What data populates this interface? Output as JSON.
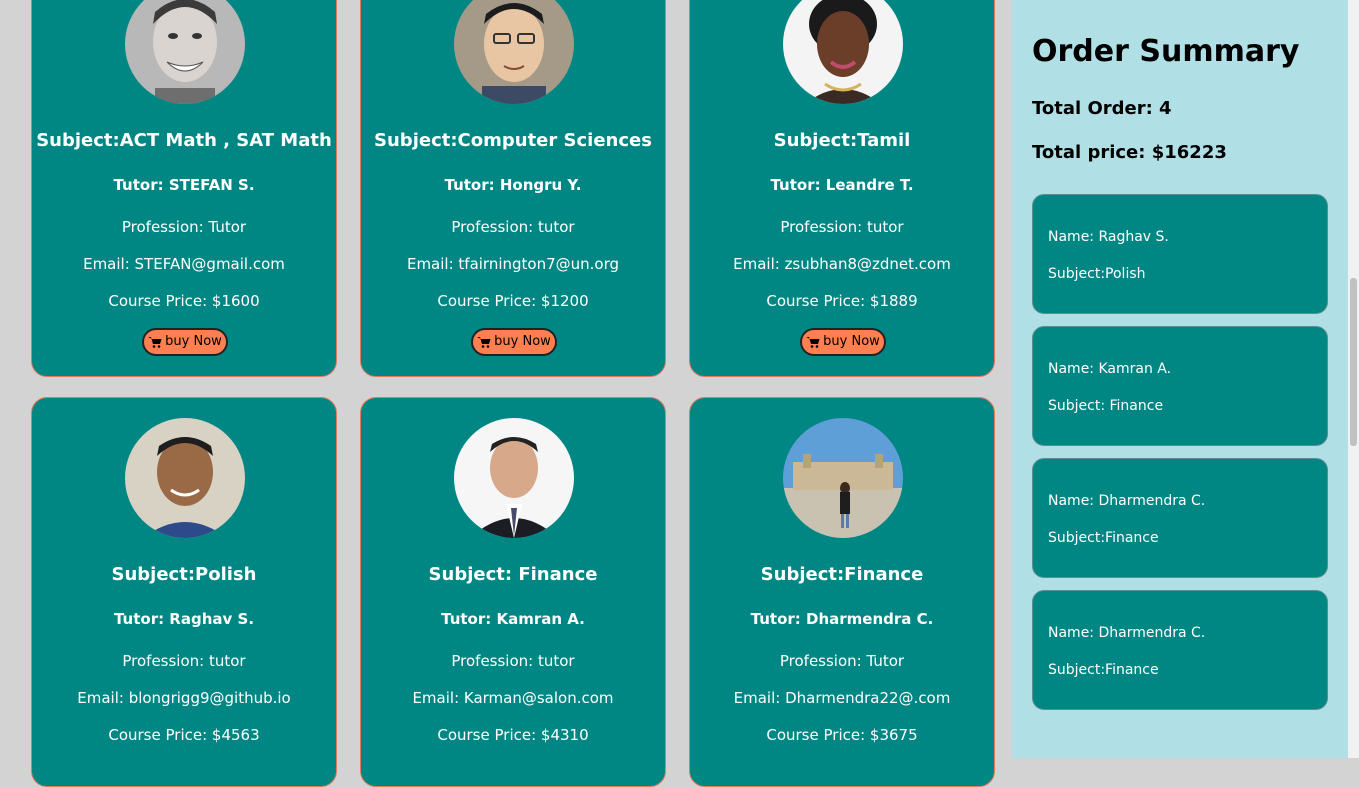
{
  "tutors": [
    {
      "subject": "Subject:ACT Math , SAT Math",
      "tutor": "Tutor: STEFAN S.",
      "profession": "Profession: Tutor",
      "email": "Email: STEFAN@gmail.com",
      "price": "Course Price: $1600",
      "button": "buy Now"
    },
    {
      "subject": "Subject:Computer Sciences",
      "tutor": "Tutor: Hongru Y.",
      "profession": "Profession: tutor",
      "email": "Email: tfairnington7@un.org",
      "price": "Course Price: $1200",
      "button": "buy Now"
    },
    {
      "subject": "Subject:Tamil",
      "tutor": "Tutor: Leandre T.",
      "profession": "Profession: tutor",
      "email": "Email: zsubhan8@zdnet.com",
      "price": "Course Price: $1889",
      "button": "buy Now"
    },
    {
      "subject": "Subject:Polish",
      "tutor": "Tutor: Raghav S.",
      "profession": "Profession: tutor",
      "email": "Email: blongrigg9@github.io",
      "price": "Course Price: $4563"
    },
    {
      "subject": "Subject: Finance",
      "tutor": "Tutor: Kamran A.",
      "profession": "Profession: tutor",
      "email": "Email: Karman@salon.com",
      "price": "Course Price: $4310"
    },
    {
      "subject": "Subject:Finance",
      "tutor": "Tutor: Dharmendra C.",
      "profession": "Profession: Tutor",
      "email": "Email: Dharmendra22@.com",
      "price": "Course Price: $3675"
    }
  ],
  "summary": {
    "title": "Order Summary",
    "total_order": "Total Order: 4",
    "total_price": "Total price: $16223",
    "orders": [
      {
        "name": "Name: Raghav S.",
        "subject": "Subject:Polish"
      },
      {
        "name": "Name: Kamran A.",
        "subject": "Subject: Finance"
      },
      {
        "name": "Name: Dharmendra C.",
        "subject": "Subject:Finance"
      },
      {
        "name": "Name: Dharmendra C.",
        "subject": "Subject:Finance"
      }
    ]
  },
  "colors": {
    "card": "#008784",
    "button": "#ff7f50",
    "sidebar": "#b0e0e6",
    "page": "#d3d3d3"
  },
  "icons": {
    "buy_button": "shopping-cart-icon"
  }
}
